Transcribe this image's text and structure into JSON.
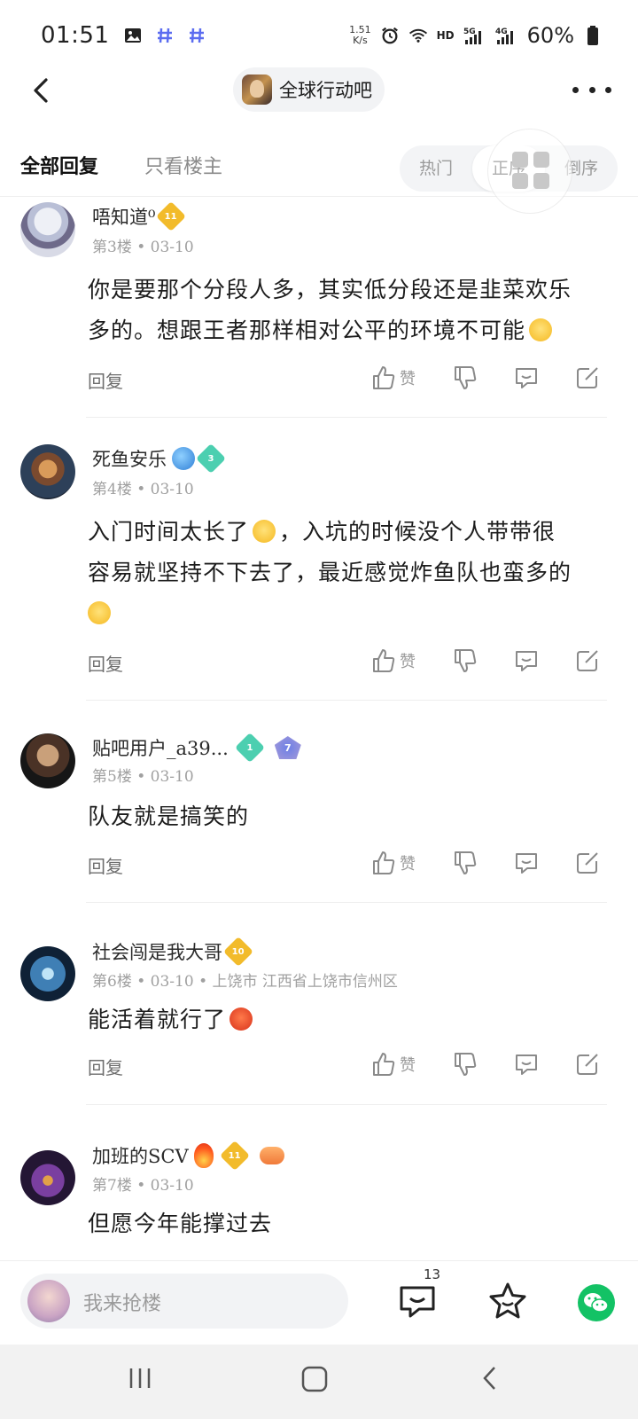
{
  "status_bar": {
    "time": "01:51",
    "net_speed_value": "1.51",
    "net_speed_unit": "K/s",
    "network_labels": [
      "HD",
      "5G",
      "4G"
    ],
    "battery": "60%"
  },
  "nav": {
    "forum_name": "全球行动吧"
  },
  "tabs": {
    "all_replies": "全部回复",
    "owner_only": "只看楼主"
  },
  "sort": {
    "hot": "热门",
    "asc": "正序",
    "desc": "倒序",
    "selected": "正序"
  },
  "posts": [
    {
      "username": "唔知道⁰",
      "badges": [
        {
          "type": "gold",
          "level": "11"
        }
      ],
      "floor": "第3楼",
      "date": "03-10",
      "location": "",
      "content_lines": [
        "你是要那个分段人多，其实低分段还是韭菜欢乐",
        "多的。想跟王者那样相对公平的环境不可能"
      ],
      "reply_label": "回复",
      "like_label": "赞"
    },
    {
      "username": "死鱼安乐",
      "badges": [
        {
          "type": "green",
          "level": "3"
        }
      ],
      "floor": "第4楼",
      "date": "03-10",
      "location": "",
      "content_lines": [
        "入门时间太长了",
        "，入坑的时候没个人带带很",
        "容易就坚持不下去了，最近感觉炸鱼队也蛮多的"
      ],
      "reply_label": "回复",
      "like_label": "赞"
    },
    {
      "username": "贴吧用户_a39...",
      "badges": [
        {
          "type": "green",
          "level": "1"
        },
        {
          "type": "blue",
          "level": "7"
        }
      ],
      "floor": "第5楼",
      "date": "03-10",
      "location": "",
      "content_lines": [
        "队友就是搞笑的"
      ],
      "reply_label": "回复",
      "like_label": "赞"
    },
    {
      "username": "社会闯是我大哥",
      "badges": [
        {
          "type": "gold",
          "level": "10"
        }
      ],
      "floor": "第6楼",
      "date": "03-10",
      "location": "上饶市 江西省上饶市信州区",
      "content_lines": [
        "能活着就行了"
      ],
      "reply_label": "回复",
      "like_label": "赞"
    },
    {
      "username": "加班的SCV",
      "badges": [
        {
          "type": "gold",
          "level": "11"
        }
      ],
      "floor": "第7楼",
      "date": "03-10",
      "location": "",
      "content_lines": [
        "但愿今年能撑过去"
      ],
      "reply_label": "回复",
      "like_label": "赞"
    }
  ],
  "bottom_bar": {
    "input_placeholder": "我来抢楼",
    "comment_count": "13"
  },
  "colors": {
    "wechat_green": "#13c265",
    "gold_badge": "#f2bb2b",
    "green_badge": "#4ccfb0"
  }
}
